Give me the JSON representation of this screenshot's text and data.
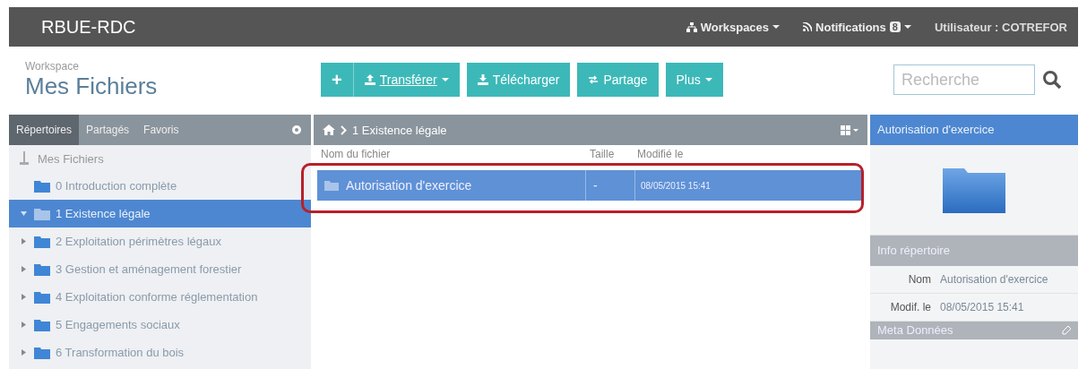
{
  "topbar": {
    "brand": "RBUE-RDC",
    "workspaces": "Workspaces",
    "notifications": "Notifications",
    "notification_count": "8",
    "user": "Utilisateur : COTREFOR"
  },
  "header": {
    "caption": "Workspace",
    "title": "Mes Fichiers"
  },
  "toolbar": {
    "buttons": [
      {
        "kind": "icon",
        "label": "+"
      },
      {
        "kind": "dropdown",
        "label": "Transférer"
      },
      {
        "kind": "plain",
        "label": "Télécharger"
      },
      {
        "kind": "plain",
        "label": "Partage"
      },
      {
        "kind": "dropdown",
        "label": "Plus"
      }
    ]
  },
  "search": {
    "placeholder": "Recherche"
  },
  "sidebar": {
    "tabs": [
      {
        "label": "Répertoires",
        "selected": true
      },
      {
        "label": "Partagés",
        "selected": false
      },
      {
        "label": "Favoris",
        "selected": false
      }
    ],
    "tree": {
      "label": "Mes Fichiers",
      "children": [
        {
          "label": "0 Introduction complète",
          "kind": "leaf",
          "selected": false
        },
        {
          "label": "1 Existence légale",
          "kind": "branch",
          "expanded": true,
          "selected": true
        },
        {
          "label": "2 Exploitation périmètres légaux",
          "kind": "branch",
          "expanded": false,
          "selected": false
        },
        {
          "label": "3 Gestion et aménagement forestier",
          "kind": "branch",
          "expanded": false,
          "selected": false
        },
        {
          "label": "4 Exploitation conforme réglementation",
          "kind": "branch",
          "expanded": false,
          "selected": false
        },
        {
          "label": "5 Engagements sociaux",
          "kind": "branch",
          "expanded": false,
          "selected": false
        },
        {
          "label": "6 Transformation du bois",
          "kind": "branch",
          "expanded": false,
          "selected": false
        }
      ]
    }
  },
  "breadcrumb": "1 Existence légale",
  "table": {
    "columns": [
      "Nom du fichier",
      "Taille",
      "Modifié le"
    ],
    "rows": [
      {
        "name": "Autorisation d'exercice",
        "size": "-",
        "modified": "08/05/2015 15:41",
        "selected": true
      }
    ]
  },
  "details": {
    "title": "Autorisation d'exercice",
    "section": "Info répertoire",
    "fields": [
      {
        "label": "Nom",
        "value": "Autorisation d'exercice"
      },
      {
        "label": "Modif. le",
        "value": "08/05/2015 15:41"
      }
    ],
    "meta_section": "Meta Données"
  }
}
